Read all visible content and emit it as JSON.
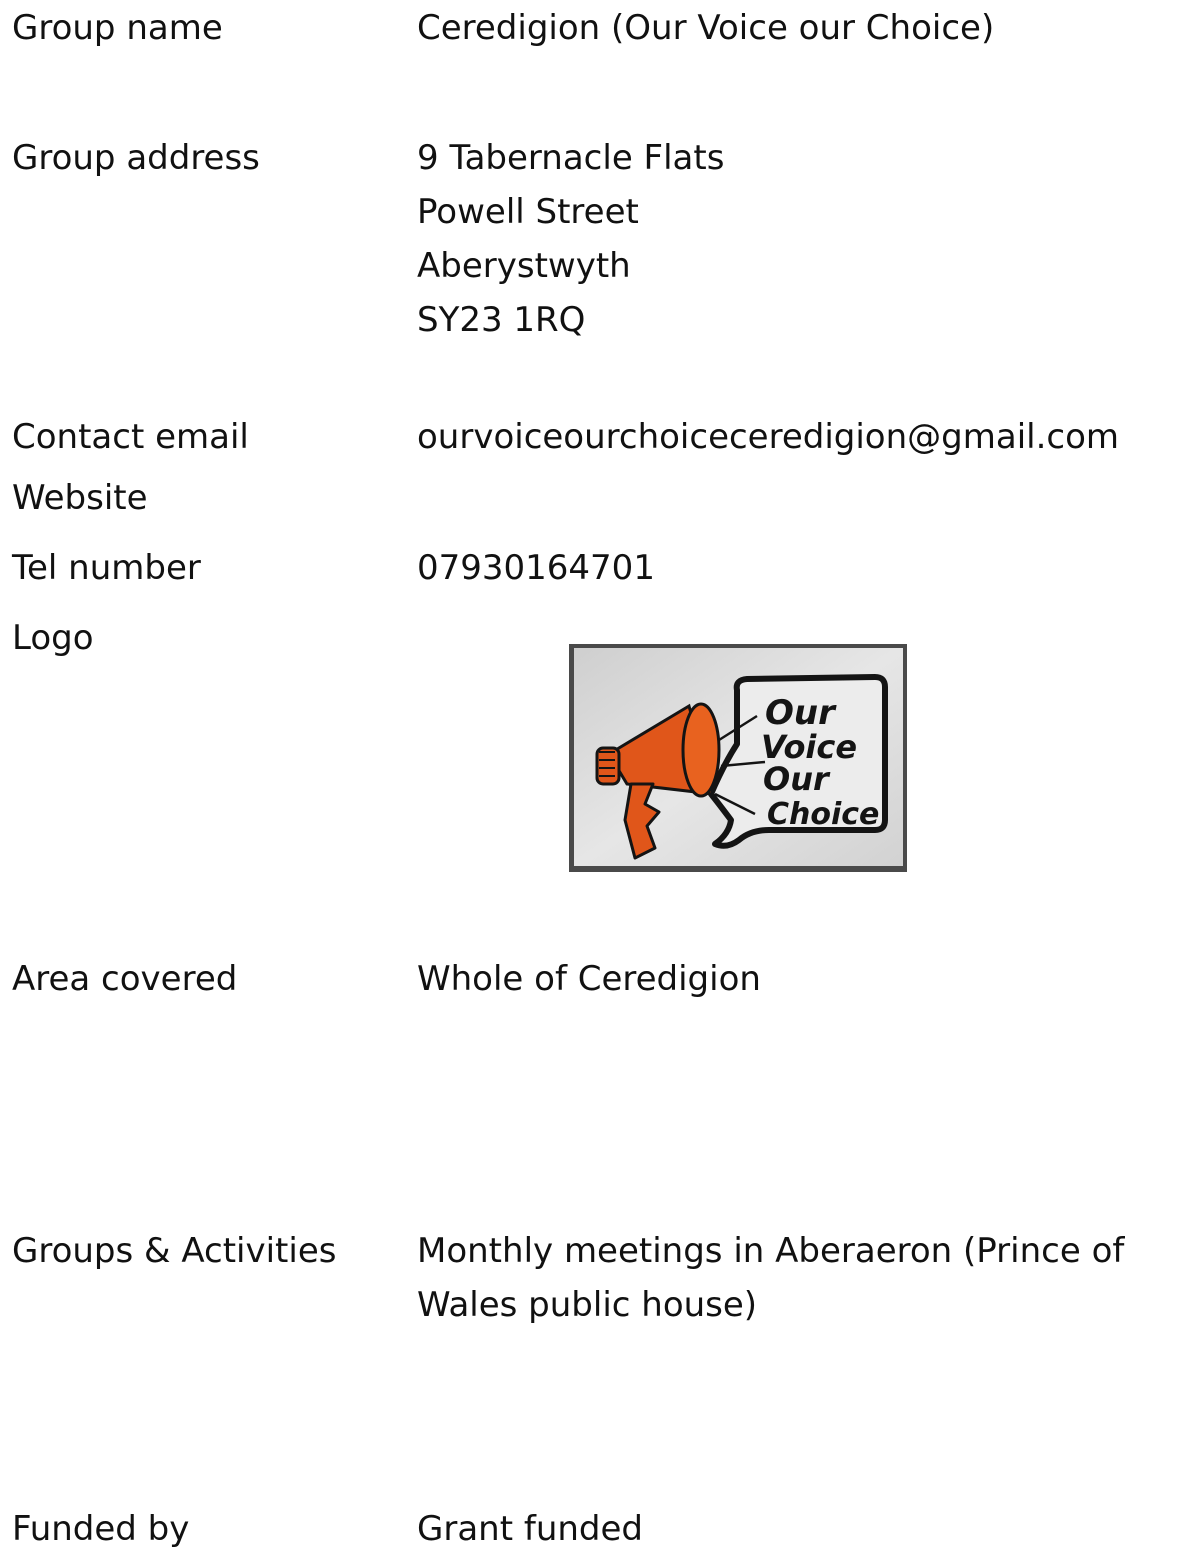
{
  "rows": {
    "group_name": {
      "label": "Group name",
      "value": "Ceredigion (Our Voice our Choice)"
    },
    "group_address": {
      "label": "Group address",
      "lines": [
        "9 Tabernacle Flats",
        "Powell Street",
        "Aberystwyth",
        "SY23 1RQ"
      ]
    },
    "contact_email": {
      "label": "Contact email",
      "value": "ourvoiceourchoiceceredigion@gmail.com"
    },
    "website": {
      "label": "Website",
      "value": ""
    },
    "tel_number": {
      "label": "Tel number",
      "value": "07930164701"
    },
    "logo": {
      "label": "Logo",
      "logo_text": [
        "Our",
        "Voice",
        "Our",
        "Choice"
      ],
      "colors": {
        "megaphone": "#e0561a",
        "paper": "#dcdcdc",
        "ink": "#141414",
        "frame": "#4a4a4a"
      }
    },
    "area_covered": {
      "label": "Area covered",
      "value": "Whole of Ceredigion"
    },
    "groups_activities": {
      "label": "Groups & Activities",
      "value": "Monthly meetings in Aberaeron (Prince of Wales public house)"
    },
    "funded_by": {
      "label": "Funded by",
      "value": "Grant funded"
    }
  }
}
